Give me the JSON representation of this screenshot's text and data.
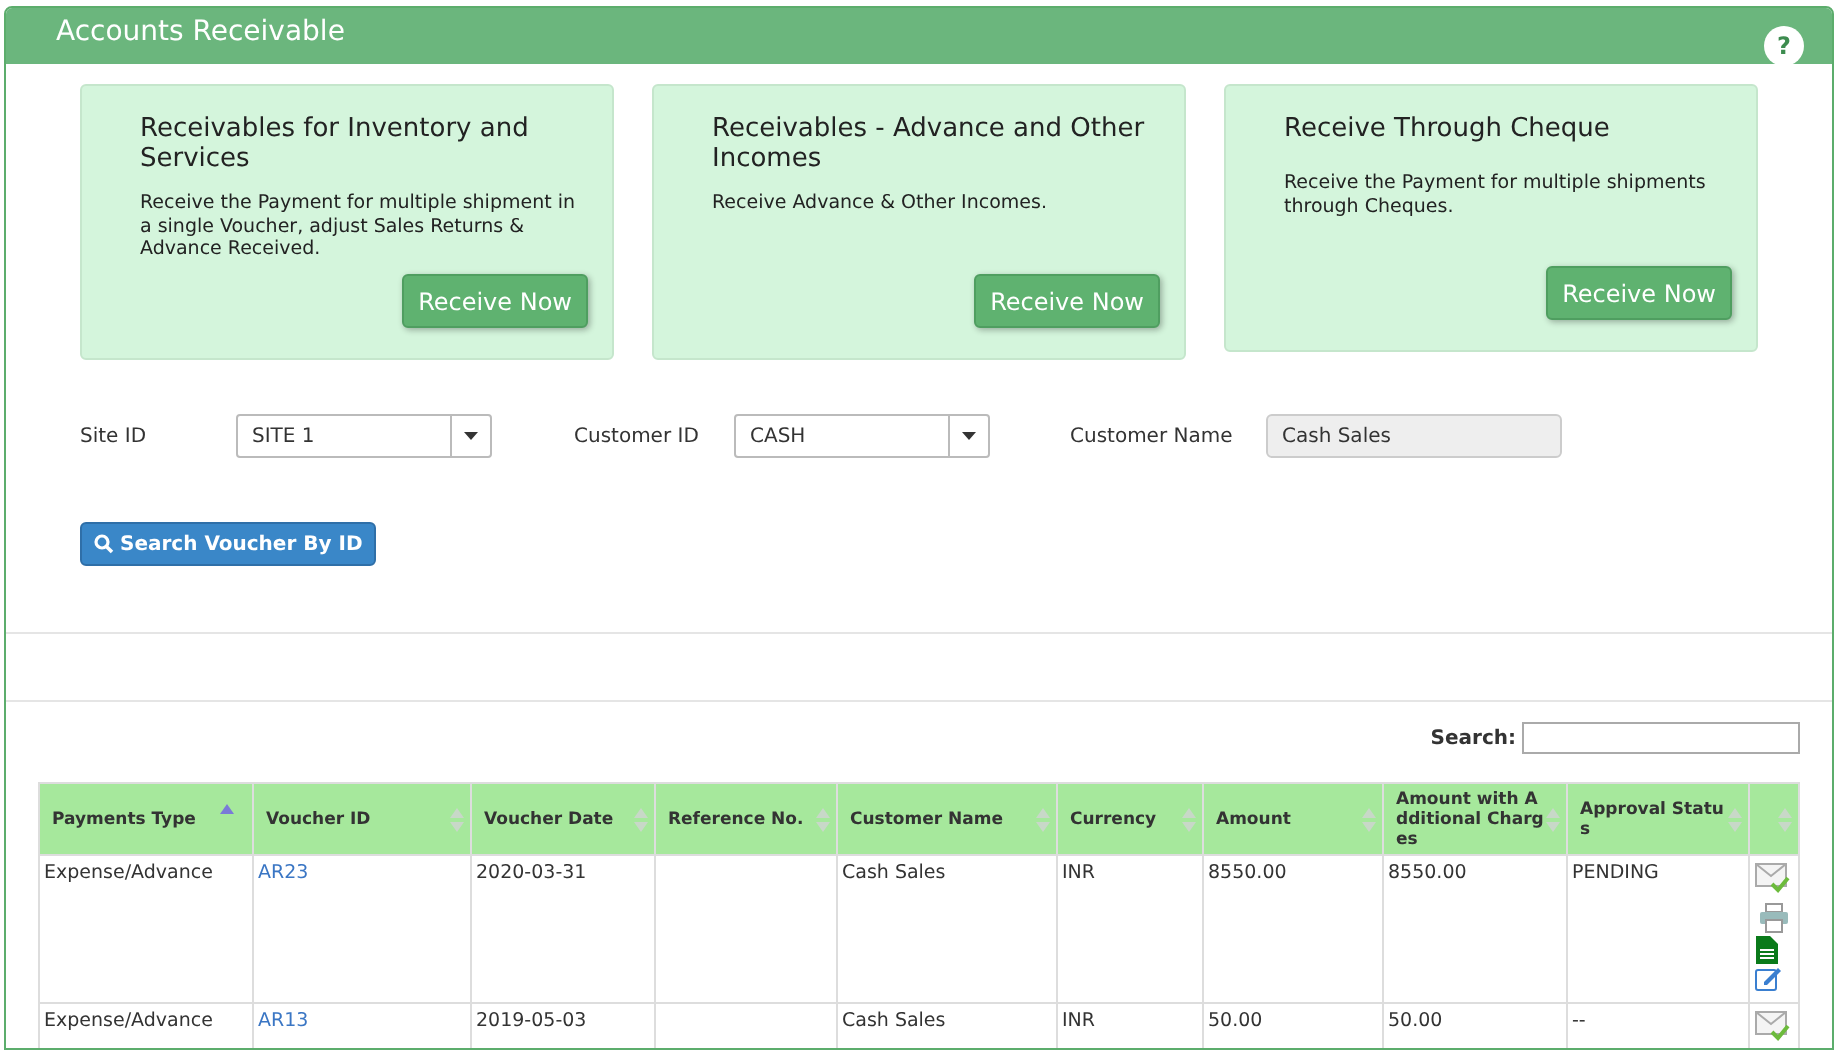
{
  "header": {
    "title": "Accounts Receivable",
    "help": "?"
  },
  "cards": [
    {
      "title": "Receivables for Inventory and Services",
      "description": "Receive the Payment for multiple shipment in a single Voucher, adjust Sales Returns & Advance Received.",
      "button": "Receive Now"
    },
    {
      "title": "Receivables - Advance and Other Incomes",
      "description": "Receive Advance & Other Incomes.",
      "button": "Receive Now"
    },
    {
      "title": "Receive Through Cheque",
      "description": "Receive the Payment for multiple shipments through Cheques.",
      "button": "Receive Now"
    }
  ],
  "filters": [
    {
      "kind": "select",
      "label": "Site ID",
      "value": "SITE 1"
    },
    {
      "kind": "select",
      "label": "Customer ID",
      "value": "CASH"
    },
    {
      "kind": "readonly",
      "label": "Customer Name",
      "value": "Cash Sales"
    }
  ],
  "search_button": "Search Voucher By ID",
  "table_search": {
    "label": "Search:"
  },
  "table": {
    "columns": [
      {
        "label": "Payments Type",
        "sorted": true
      },
      {
        "label": "Voucher ID",
        "sorted": false
      },
      {
        "label": "Voucher Date",
        "sorted": false
      },
      {
        "label": "Reference No.",
        "sorted": false
      },
      {
        "label": "Customer Name",
        "sorted": false
      },
      {
        "label": "Currency",
        "sorted": false
      },
      {
        "label": "Amount",
        "sorted": false
      },
      {
        "label": "Amount with Additional Charges",
        "sorted": false
      },
      {
        "label": "Approval Status",
        "sorted": false
      },
      {
        "sorted": false
      }
    ],
    "rows": [
      {
        "payments_type": "Expense/Advance",
        "voucher_id": "AR23",
        "voucher_date": "2020-03-31",
        "reference_no": "",
        "customer_name": "Cash Sales",
        "currency": "INR",
        "amount": "8550.00",
        "amount_with_charges": "8550.00",
        "approval_status": "PENDING"
      },
      {
        "payments_type": "Expense/Advance",
        "voucher_id": "AR13",
        "voucher_date": "2019-05-03",
        "reference_no": "",
        "customer_name": "Cash Sales",
        "currency": "INR",
        "amount": "50.00",
        "amount_with_charges": "50.00",
        "approval_status": "--"
      }
    ]
  }
}
